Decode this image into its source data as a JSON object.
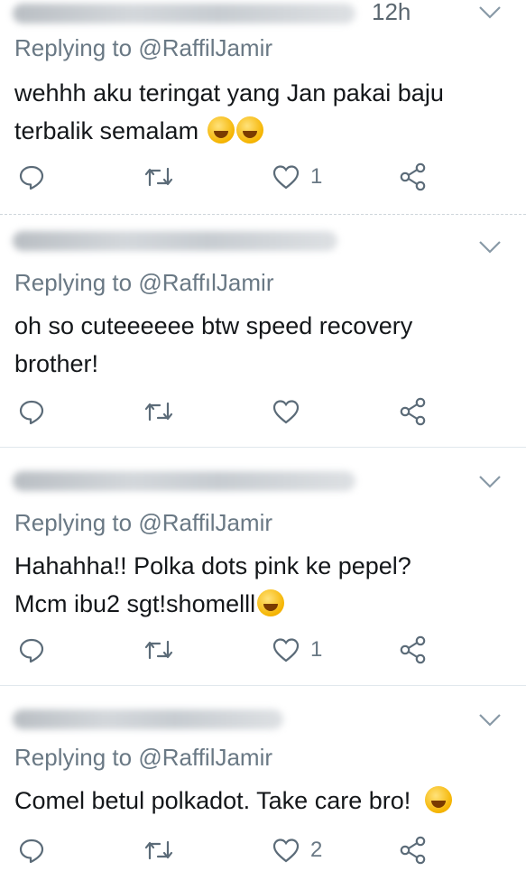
{
  "tweets": [
    {
      "time": "12h",
      "replying_prefix": "Replying to",
      "replying_handle": "@RaffilJamir",
      "text": "wehhh aku teringat yang Jan pakai baju terbalik semalam",
      "emoji": [
        "rofl-emoji",
        "rofl-emoji"
      ],
      "reply_count": "",
      "retweet_count": "",
      "like_count": "1"
    },
    {
      "time": "",
      "replying_prefix": "Replying to",
      "replying_handle": "@RaffılJamir",
      "text": "oh so cuteeeeee btw speed recovery brother!",
      "emoji": [],
      "reply_count": "",
      "retweet_count": "",
      "like_count": ""
    },
    {
      "time": "",
      "replying_prefix": "Replying to",
      "replying_handle": "@RaffilJamir",
      "text": "Hahahha!! Polka dots pink ke pepel? Mcm ibu2 sgt!shomelll",
      "emoji": [
        "tears-of-joy-emoji"
      ],
      "reply_count": "",
      "retweet_count": "",
      "like_count": "1"
    },
    {
      "time": "",
      "replying_prefix": "Replying to",
      "replying_handle": "@RaffilJamir",
      "text": "Comel betul polkadot. Take care bro!",
      "emoji": [
        "grinning-emoji"
      ],
      "reply_count": "",
      "retweet_count": "",
      "like_count": "2"
    }
  ],
  "icons": {
    "reply": "reply-icon",
    "retweet": "retweet-icon",
    "like": "heart-icon",
    "share": "share-icon",
    "menu": "chevron-down-icon"
  },
  "colors": {
    "text": "#14171a",
    "muted": "#697884",
    "divider": "#e1e8ed"
  }
}
